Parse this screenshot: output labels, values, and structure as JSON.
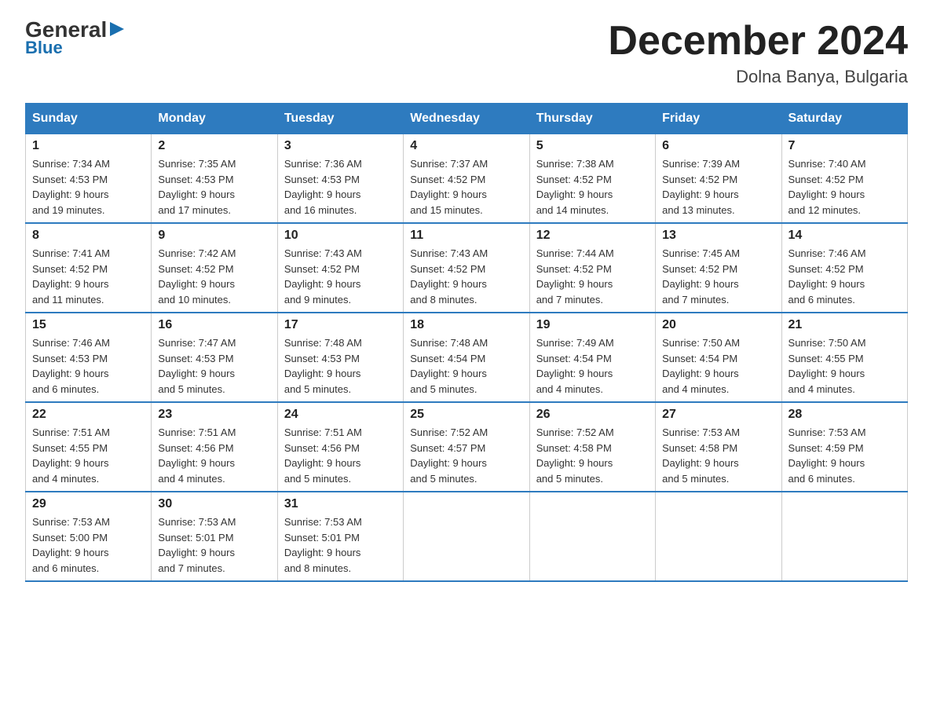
{
  "header": {
    "logo_general": "General",
    "logo_blue": "Blue",
    "month_title": "December 2024",
    "location": "Dolna Banya, Bulgaria"
  },
  "days_of_week": [
    "Sunday",
    "Monday",
    "Tuesday",
    "Wednesday",
    "Thursday",
    "Friday",
    "Saturday"
  ],
  "weeks": [
    [
      {
        "day": "1",
        "sunrise": "7:34 AM",
        "sunset": "4:53 PM",
        "daylight": "9 hours and 19 minutes."
      },
      {
        "day": "2",
        "sunrise": "7:35 AM",
        "sunset": "4:53 PM",
        "daylight": "9 hours and 17 minutes."
      },
      {
        "day": "3",
        "sunrise": "7:36 AM",
        "sunset": "4:53 PM",
        "daylight": "9 hours and 16 minutes."
      },
      {
        "day": "4",
        "sunrise": "7:37 AM",
        "sunset": "4:52 PM",
        "daylight": "9 hours and 15 minutes."
      },
      {
        "day": "5",
        "sunrise": "7:38 AM",
        "sunset": "4:52 PM",
        "daylight": "9 hours and 14 minutes."
      },
      {
        "day": "6",
        "sunrise": "7:39 AM",
        "sunset": "4:52 PM",
        "daylight": "9 hours and 13 minutes."
      },
      {
        "day": "7",
        "sunrise": "7:40 AM",
        "sunset": "4:52 PM",
        "daylight": "9 hours and 12 minutes."
      }
    ],
    [
      {
        "day": "8",
        "sunrise": "7:41 AM",
        "sunset": "4:52 PM",
        "daylight": "9 hours and 11 minutes."
      },
      {
        "day": "9",
        "sunrise": "7:42 AM",
        "sunset": "4:52 PM",
        "daylight": "9 hours and 10 minutes."
      },
      {
        "day": "10",
        "sunrise": "7:43 AM",
        "sunset": "4:52 PM",
        "daylight": "9 hours and 9 minutes."
      },
      {
        "day": "11",
        "sunrise": "7:43 AM",
        "sunset": "4:52 PM",
        "daylight": "9 hours and 8 minutes."
      },
      {
        "day": "12",
        "sunrise": "7:44 AM",
        "sunset": "4:52 PM",
        "daylight": "9 hours and 7 minutes."
      },
      {
        "day": "13",
        "sunrise": "7:45 AM",
        "sunset": "4:52 PM",
        "daylight": "9 hours and 7 minutes."
      },
      {
        "day": "14",
        "sunrise": "7:46 AM",
        "sunset": "4:52 PM",
        "daylight": "9 hours and 6 minutes."
      }
    ],
    [
      {
        "day": "15",
        "sunrise": "7:46 AM",
        "sunset": "4:53 PM",
        "daylight": "9 hours and 6 minutes."
      },
      {
        "day": "16",
        "sunrise": "7:47 AM",
        "sunset": "4:53 PM",
        "daylight": "9 hours and 5 minutes."
      },
      {
        "day": "17",
        "sunrise": "7:48 AM",
        "sunset": "4:53 PM",
        "daylight": "9 hours and 5 minutes."
      },
      {
        "day": "18",
        "sunrise": "7:48 AM",
        "sunset": "4:54 PM",
        "daylight": "9 hours and 5 minutes."
      },
      {
        "day": "19",
        "sunrise": "7:49 AM",
        "sunset": "4:54 PM",
        "daylight": "9 hours and 4 minutes."
      },
      {
        "day": "20",
        "sunrise": "7:50 AM",
        "sunset": "4:54 PM",
        "daylight": "9 hours and 4 minutes."
      },
      {
        "day": "21",
        "sunrise": "7:50 AM",
        "sunset": "4:55 PM",
        "daylight": "9 hours and 4 minutes."
      }
    ],
    [
      {
        "day": "22",
        "sunrise": "7:51 AM",
        "sunset": "4:55 PM",
        "daylight": "9 hours and 4 minutes."
      },
      {
        "day": "23",
        "sunrise": "7:51 AM",
        "sunset": "4:56 PM",
        "daylight": "9 hours and 4 minutes."
      },
      {
        "day": "24",
        "sunrise": "7:51 AM",
        "sunset": "4:56 PM",
        "daylight": "9 hours and 5 minutes."
      },
      {
        "day": "25",
        "sunrise": "7:52 AM",
        "sunset": "4:57 PM",
        "daylight": "9 hours and 5 minutes."
      },
      {
        "day": "26",
        "sunrise": "7:52 AM",
        "sunset": "4:58 PM",
        "daylight": "9 hours and 5 minutes."
      },
      {
        "day": "27",
        "sunrise": "7:53 AM",
        "sunset": "4:58 PM",
        "daylight": "9 hours and 5 minutes."
      },
      {
        "day": "28",
        "sunrise": "7:53 AM",
        "sunset": "4:59 PM",
        "daylight": "9 hours and 6 minutes."
      }
    ],
    [
      {
        "day": "29",
        "sunrise": "7:53 AM",
        "sunset": "5:00 PM",
        "daylight": "9 hours and 6 minutes."
      },
      {
        "day": "30",
        "sunrise": "7:53 AM",
        "sunset": "5:01 PM",
        "daylight": "9 hours and 7 minutes."
      },
      {
        "day": "31",
        "sunrise": "7:53 AM",
        "sunset": "5:01 PM",
        "daylight": "9 hours and 8 minutes."
      },
      null,
      null,
      null,
      null
    ]
  ]
}
